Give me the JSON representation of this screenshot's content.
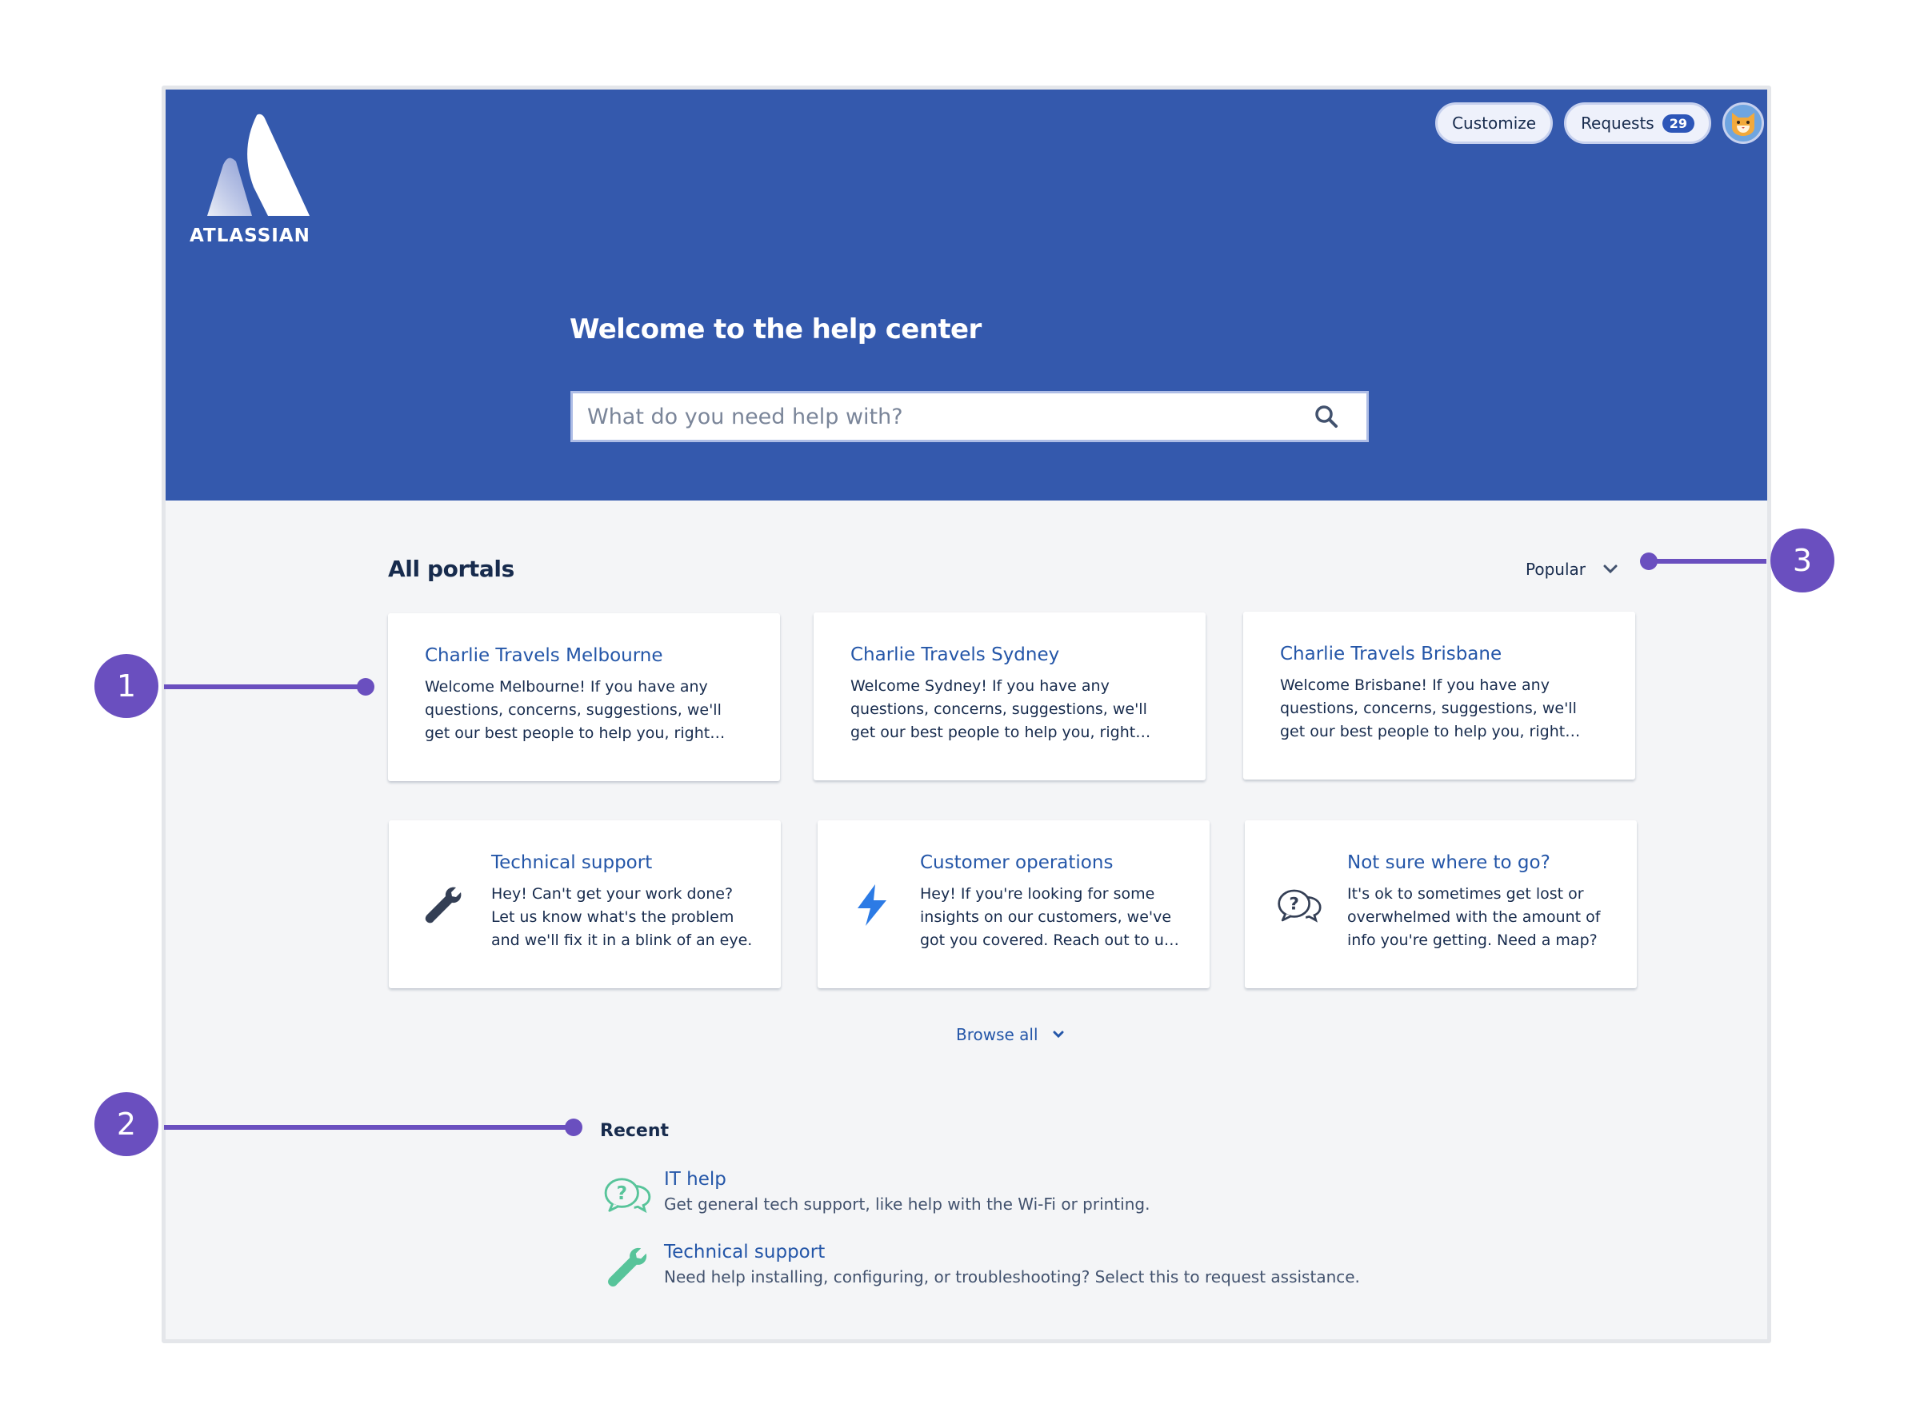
{
  "header": {
    "logo_text": "ATLASSIAN",
    "customize_label": "Customize",
    "requests_label": "Requests",
    "requests_count": "29",
    "welcome_title": "Welcome to the help center",
    "search_placeholder": "What do you need help with?"
  },
  "portals": {
    "title": "All portals",
    "sort_label": "Popular",
    "browse_all_label": "Browse all",
    "cards": [
      {
        "title": "Charlie Travels Melbourne",
        "description": "Welcome Melbourne! If you have any questions, concerns, suggestions, we'll get our best people to help you, right away."
      },
      {
        "title": "Charlie Travels Sydney",
        "description": "Welcome Sydney! If you have any questions, concerns, suggestions, we'll get our best people to help you, right away."
      },
      {
        "title": "Charlie Travels Brisbane",
        "description": "Welcome Brisbane! If you have any questions, concerns, suggestions, we'll get our best people to help you, right away."
      },
      {
        "title": "Technical support",
        "description": "Hey! Can't get your work done? Let us know what's the problem and we'll fix it in a blink of an eye.",
        "icon": "wrench-icon"
      },
      {
        "title": "Customer operations",
        "description": "Hey! If you're looking for some insights on our customers, we've got you covered. Reach out to us anytime.",
        "icon": "lightning-icon"
      },
      {
        "title": "Not sure where to go?",
        "description": "It's ok to sometimes get lost or overwhelmed with the amount of info you're getting. Need a map?",
        "icon": "question-bubbles-icon"
      }
    ]
  },
  "recent": {
    "title": "Recent",
    "items": [
      {
        "name": "IT help",
        "description": "Get general tech support, like help with the Wi-Fi or printing.",
        "icon": "question-bubbles-icon"
      },
      {
        "name": "Technical support",
        "description": "Need help installing, configuring, or troubleshooting? Select this to request assistance.",
        "icon": "wrench-icon"
      }
    ]
  },
  "callouts": [
    "1",
    "2",
    "3"
  ],
  "colors": {
    "hero": "#3459ad",
    "link": "#2456a8",
    "callout": "#6a4fbf",
    "recent_icon": "#57c49a"
  }
}
